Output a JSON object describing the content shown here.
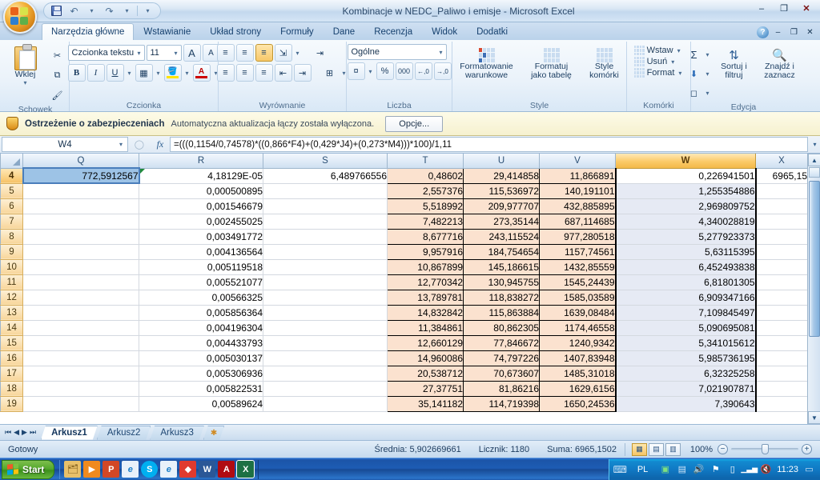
{
  "window": {
    "title": "Kombinacje w NEDC_Paliwo i emisje - Microsoft Excel",
    "minimize": "–",
    "maximize": "❐",
    "close": "✕"
  },
  "quick_access": {
    "save": "save-icon",
    "undo": "↶",
    "undo_caret": "▾",
    "redo": "↷",
    "redo_caret": "▾",
    "customize": "▾"
  },
  "ribbon": {
    "tabs": [
      {
        "label": "Narzędzia główne",
        "active": true
      },
      {
        "label": "Wstawianie",
        "active": false
      },
      {
        "label": "Układ strony",
        "active": false
      },
      {
        "label": "Formuły",
        "active": false
      },
      {
        "label": "Dane",
        "active": false
      },
      {
        "label": "Recenzja",
        "active": false
      },
      {
        "label": "Widok",
        "active": false
      },
      {
        "label": "Dodatki",
        "active": false
      }
    ],
    "help": "?",
    "ribbon_minimize": "–",
    "ribbon_restore": "❐",
    "ribbon_close": "✕",
    "groups": {
      "clipboard": {
        "label": "Schowek",
        "paste": "Wklej",
        "paste_caret": "▾",
        "cut": "✂",
        "copy": "⧉",
        "format_painter": "🖌"
      },
      "font": {
        "label": "Czcionka",
        "font_name": "Czcionka tekstu",
        "font_size": "11",
        "grow_font": "A",
        "shrink_font": "A",
        "bold": "B",
        "italic": "I",
        "underline": "U",
        "borders": "▦",
        "fill_color": "A",
        "font_color": "A"
      },
      "alignment": {
        "label": "Wyrównanie",
        "align_top": "≡",
        "align_middle": "≡",
        "align_bottom": "≡",
        "orientation": "⇲",
        "wrap_text": "⇥",
        "align_left": "≡",
        "align_center": "≡",
        "align_right": "≡",
        "decrease_indent": "⇤",
        "increase_indent": "⇥",
        "merge_center": "⊞"
      },
      "number": {
        "label": "Liczba",
        "format": "Ogólne",
        "currency": "¤",
        "percent": "%",
        "comma": "000",
        "increase_decimal": "←,0",
        "decrease_decimal": "→,0"
      },
      "styles": {
        "label": "Style",
        "conditional": "Formatowanie warunkowe",
        "as_table": "Formatuj jako tabelę",
        "cell_styles": "Style komórki",
        "caret": "▾"
      },
      "cells": {
        "label": "Komórki",
        "insert": "Wstaw",
        "delete": "Usuń",
        "format": "Format",
        "caret": "▾"
      },
      "editing": {
        "label": "Edycja",
        "autosum": "Σ",
        "fill": "⬇",
        "clear": "◻",
        "sort_filter": "Sortuj i filtruj",
        "find_select": "Znajdź i zaznacz",
        "caret": "▾"
      }
    }
  },
  "security_bar": {
    "title": "Ostrzeżenie o zabezpieczeniach",
    "message": "Automatyczna aktualizacja łączy została wyłączona.",
    "options_button": "Opcje..."
  },
  "formula_bar": {
    "name_box": "W4",
    "cancel": "✕",
    "enter": "✓",
    "function_icon": "fx",
    "formula": "=(((0,1154/0,74578)*((0,866*F4)+(0,429*J4)+(0,273*M4)))*100)/1,11",
    "expand": "▾"
  },
  "grid": {
    "select_all": "select-all-corner",
    "columns": [
      "Q",
      "R",
      "S",
      "T",
      "U",
      "V",
      "W",
      "X"
    ],
    "selected_column": "W",
    "row_numbers": [
      "4",
      "5",
      "6",
      "7",
      "8",
      "9",
      "10",
      "11",
      "12",
      "13",
      "14",
      "15",
      "16",
      "17",
      "18",
      "19"
    ],
    "selected_row": "4",
    "rows": [
      {
        "Q": "772,5912567",
        "R": "4,18129E-05",
        "S": "6,489766556",
        "T": "0,48602",
        "U": "29,414858",
        "V": "11,866891",
        "W": "0,226941501",
        "X": "6965,15"
      },
      {
        "Q": "",
        "R": "0,000500895",
        "S": "",
        "T": "2,557376",
        "U": "115,536972",
        "V": "140,191101",
        "W": "1,255354886",
        "X": ""
      },
      {
        "Q": "",
        "R": "0,001546679",
        "S": "",
        "T": "5,518992",
        "U": "209,977707",
        "V": "432,885895",
        "W": "2,969809752",
        "X": ""
      },
      {
        "Q": "",
        "R": "0,002455025",
        "S": "",
        "T": "7,482213",
        "U": "273,35144",
        "V": "687,114685",
        "W": "4,340028819",
        "X": ""
      },
      {
        "Q": "",
        "R": "0,003491772",
        "S": "",
        "T": "8,677716",
        "U": "243,115524",
        "V": "977,280518",
        "W": "5,277923373",
        "X": ""
      },
      {
        "Q": "",
        "R": "0,004136564",
        "S": "",
        "T": "9,957916",
        "U": "184,754654",
        "V": "1157,74561",
        "W": "5,63115395",
        "X": ""
      },
      {
        "Q": "",
        "R": "0,005119518",
        "S": "",
        "T": "10,867899",
        "U": "145,186615",
        "V": "1432,85559",
        "W": "6,452493838",
        "X": ""
      },
      {
        "Q": "",
        "R": "0,005521077",
        "S": "",
        "T": "12,770342",
        "U": "130,945755",
        "V": "1545,24439",
        "W": "6,81801305",
        "X": ""
      },
      {
        "Q": "",
        "R": "0,00566325",
        "S": "",
        "T": "13,789781",
        "U": "118,838272",
        "V": "1585,03589",
        "W": "6,909347166",
        "X": ""
      },
      {
        "Q": "",
        "R": "0,005856364",
        "S": "",
        "T": "14,832842",
        "U": "115,863884",
        "V": "1639,08484",
        "W": "7,109845497",
        "X": ""
      },
      {
        "Q": "",
        "R": "0,004196304",
        "S": "",
        "T": "11,384861",
        "U": "80,862305",
        "V": "1174,46558",
        "W": "5,090695081",
        "X": ""
      },
      {
        "Q": "",
        "R": "0,004433793",
        "S": "",
        "T": "12,660129",
        "U": "77,846672",
        "V": "1240,9342",
        "W": "5,341015612",
        "X": ""
      },
      {
        "Q": "",
        "R": "0,005030137",
        "S": "",
        "T": "14,960086",
        "U": "74,797226",
        "V": "1407,83948",
        "W": "5,985736195",
        "X": ""
      },
      {
        "Q": "",
        "R": "0,005306936",
        "S": "",
        "T": "20,538712",
        "U": "70,673607",
        "V": "1485,31018",
        "W": "6,32325258",
        "X": ""
      },
      {
        "Q": "",
        "R": "0,005822531",
        "S": "",
        "T": "27,37751",
        "U": "81,86216",
        "V": "1629,6156",
        "W": "7,021907871",
        "X": ""
      },
      {
        "Q": "",
        "R": "0,00589624",
        "S": "",
        "T": "35,141182",
        "U": "114,719398",
        "V": "1650,24536",
        "W": "7,390643",
        "X": ""
      }
    ],
    "scroll": {
      "up": "▲",
      "down": "▼",
      "split": "split-box"
    }
  },
  "sheet_tabs": {
    "nav_first": "⏮",
    "nav_prev": "◀",
    "nav_next": "▶",
    "nav_last": "⏭",
    "tabs": [
      {
        "label": "Arkusz1",
        "active": true
      },
      {
        "label": "Arkusz2",
        "active": false
      },
      {
        "label": "Arkusz3",
        "active": false
      }
    ],
    "insert_sheet": "insert-worksheet-icon"
  },
  "status_bar": {
    "mode": "Gotowy",
    "average": "Średnia: 5,902669661",
    "count": "Licznik: 1180",
    "sum": "Suma: 6965,1502",
    "view_normal": "▦",
    "view_layout": "▤",
    "view_pagebreak": "▥",
    "zoom_level": "100%",
    "zoom_out": "−",
    "zoom_in": "+"
  },
  "taskbar": {
    "start": "Start",
    "quick_launch": [
      {
        "name": "show-desktop-icon",
        "glyph": "🗂",
        "color": "#e8c06a"
      },
      {
        "name": "media-player-icon",
        "glyph": "▶",
        "color": "#f08a1e"
      },
      {
        "name": "powerpoint-icon",
        "glyph": "P",
        "color": "#d24726"
      },
      {
        "name": "internet-explorer-icon",
        "glyph": "e",
        "color": "#1a7ec8"
      },
      {
        "name": "skype-icon",
        "glyph": "S",
        "color": "#00aff0"
      },
      {
        "name": "internet-explorer2-icon",
        "glyph": "e",
        "color": "#1a7ec8"
      },
      {
        "name": "foxit-reader-icon",
        "glyph": "◆",
        "color": "#e03a2f"
      },
      {
        "name": "word-icon",
        "glyph": "W",
        "color": "#2b5797"
      },
      {
        "name": "acrobat-icon",
        "glyph": "A",
        "color": "#b00b11"
      },
      {
        "name": "excel-icon",
        "glyph": "X",
        "color": "#1d7044"
      }
    ],
    "language": "PL",
    "tray": [
      {
        "name": "antivirus-icon",
        "glyph": "▣"
      },
      {
        "name": "network-icon",
        "glyph": "▤"
      },
      {
        "name": "volume-icon",
        "glyph": "🔊"
      },
      {
        "name": "flag-icon",
        "glyph": "⚑"
      },
      {
        "name": "battery-icon",
        "glyph": "▯"
      },
      {
        "name": "signal-icon",
        "glyph": "▁▃▅"
      },
      {
        "name": "mute-icon",
        "glyph": "🔇"
      }
    ],
    "clock": "11:23",
    "show_desktop": "▭",
    "keyboard_icon": "⌨"
  }
}
